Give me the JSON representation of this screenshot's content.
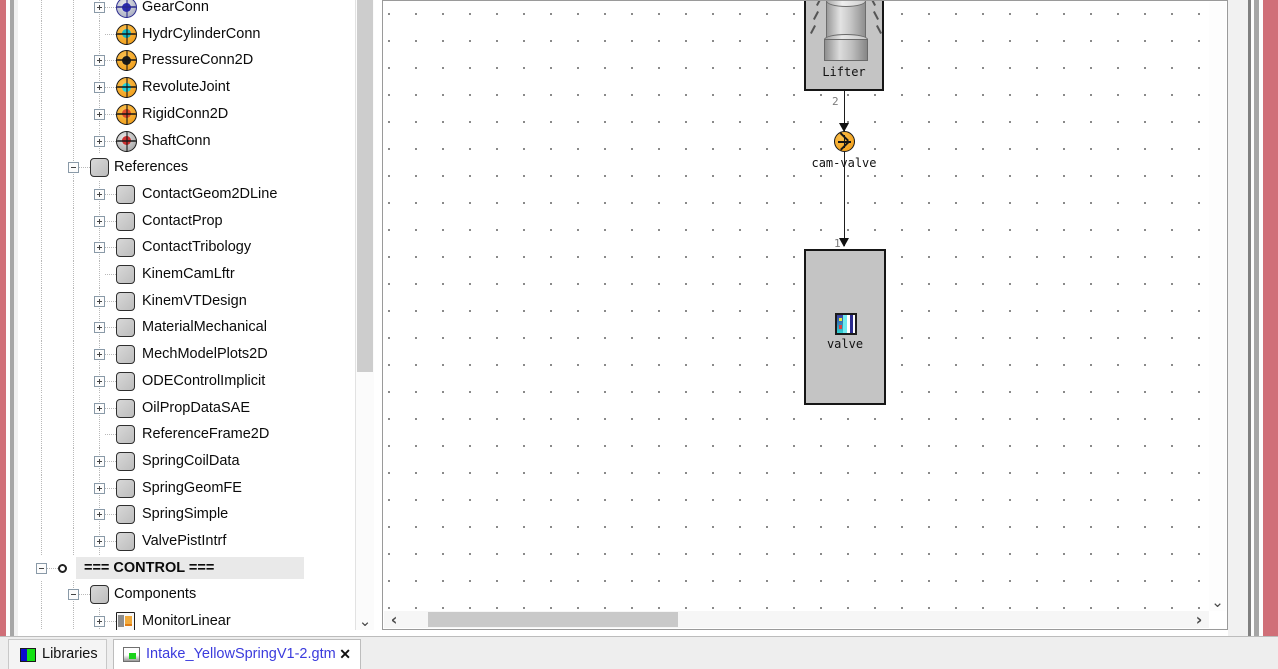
{
  "window": {
    "border_color": "#d06f78"
  },
  "tree": {
    "scrollbar": {
      "down_arrow": "⌄"
    },
    "items": [
      {
        "label": "GearConn",
        "indent": 2,
        "expander": "plus",
        "icon": "gearconn-icon"
      },
      {
        "label": "HydrCylinderConn",
        "indent": 2,
        "expander": "none",
        "icon": "hydrcylinderconn-icon"
      },
      {
        "label": "PressureConn2D",
        "indent": 2,
        "expander": "plus",
        "icon": "pressureconn2d-icon"
      },
      {
        "label": "RevoluteJoint",
        "indent": 2,
        "expander": "plus",
        "icon": "revolutejoint-icon"
      },
      {
        "label": "RigidConn2D",
        "indent": 2,
        "expander": "plus",
        "icon": "rigidconn2d-icon"
      },
      {
        "label": "ShaftConn",
        "indent": 2,
        "expander": "plus",
        "icon": "shaftconn-icon"
      },
      {
        "label": "References",
        "indent": 1,
        "expander": "minus",
        "icon": "folder-node-icon"
      },
      {
        "label": "ContactGeom2DLine",
        "indent": 2,
        "expander": "plus",
        "icon": "folder-node-icon"
      },
      {
        "label": "ContactProp",
        "indent": 2,
        "expander": "plus",
        "icon": "folder-node-icon"
      },
      {
        "label": "ContactTribology",
        "indent": 2,
        "expander": "plus",
        "icon": "folder-node-icon"
      },
      {
        "label": "KinemCamLftr",
        "indent": 2,
        "expander": "none",
        "icon": "folder-node-icon"
      },
      {
        "label": "KinemVTDesign",
        "indent": 2,
        "expander": "plus",
        "icon": "folder-node-icon"
      },
      {
        "label": "MaterialMechanical",
        "indent": 2,
        "expander": "plus",
        "icon": "folder-node-icon"
      },
      {
        "label": "MechModelPlots2D",
        "indent": 2,
        "expander": "plus",
        "icon": "folder-node-icon"
      },
      {
        "label": "ODEControlImplicit",
        "indent": 2,
        "expander": "plus",
        "icon": "folder-node-icon"
      },
      {
        "label": "OilPropDataSAE",
        "indent": 2,
        "expander": "plus",
        "icon": "folder-node-icon"
      },
      {
        "label": "ReferenceFrame2D",
        "indent": 2,
        "expander": "none",
        "icon": "folder-node-icon"
      },
      {
        "label": "SpringCoilData",
        "indent": 2,
        "expander": "plus",
        "icon": "folder-node-icon"
      },
      {
        "label": "SpringGeomFE",
        "indent": 2,
        "expander": "plus",
        "icon": "folder-node-icon"
      },
      {
        "label": "SpringSimple",
        "indent": 2,
        "expander": "plus",
        "icon": "folder-node-icon"
      },
      {
        "label": "ValvePistIntrf",
        "indent": 2,
        "expander": "plus",
        "icon": "folder-node-icon"
      },
      {
        "label": "=== CONTROL ===",
        "indent": 0,
        "expander": "minus",
        "icon": "bullet-node-icon",
        "bold": true,
        "selected": true
      },
      {
        "label": "Components",
        "indent": 1,
        "expander": "minus",
        "icon": "folder-node-icon"
      },
      {
        "label": "MonitorLinear",
        "indent": 2,
        "expander": "plus",
        "icon": "monitorlinear-icon"
      }
    ]
  },
  "canvas": {
    "blocks": [
      {
        "id": "lifter",
        "label": "Lifter",
        "icon": "cylinder-lifter-icon"
      },
      {
        "id": "valve",
        "label": "valve",
        "icon": "valve-icon"
      }
    ],
    "joints": [
      {
        "id": "cam-valve",
        "label": "cam-valve",
        "icon": "cam-valve-joint-icon"
      }
    ],
    "connections": [
      {
        "from": "lifter",
        "to": "cam-valve",
        "label": "2"
      },
      {
        "from": "cam-valve",
        "to": "valve",
        "label": "1"
      }
    ],
    "hscroll": {
      "left_arrow": "‹",
      "right_arrow": "›"
    },
    "vscroll": {
      "down_arrow": "⌄"
    }
  },
  "tabbar": {
    "tabs": [
      {
        "label": "Libraries",
        "icon": "libraries-icon",
        "closable": false,
        "active": false
      },
      {
        "label": "Intake_YellowSpringV1-2.gtm",
        "icon": "gtm-file-icon",
        "closable": true,
        "active": true,
        "close_glyph": "✕"
      }
    ]
  }
}
